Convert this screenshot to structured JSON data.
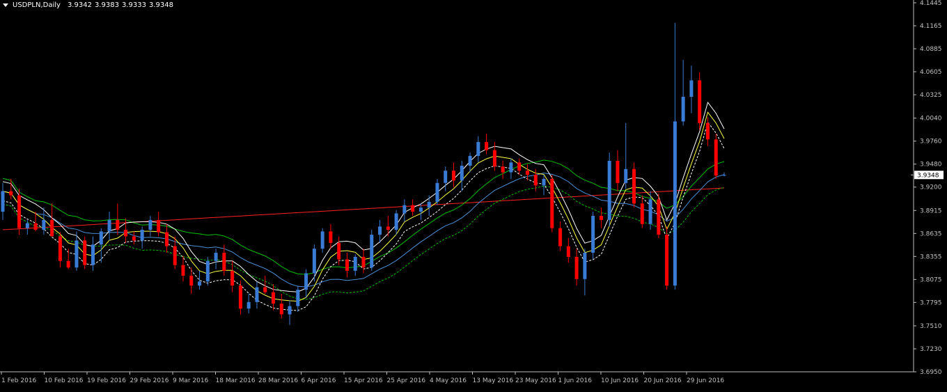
{
  "header": {
    "symbol": "USDPLN,Daily",
    "open": "3.9342",
    "high": "3.9383",
    "low": "3.9333",
    "close": "3.9348"
  },
  "colors": {
    "background": "#000000",
    "axis": "#c0c0c0",
    "bull_candle": "#3a7bd5",
    "bear_candle": "#ff0000",
    "price_tag_bg": "#ffffff",
    "ma_slow": "#ff2020",
    "env_green": "#00c000",
    "env_blue": "#4a90d9",
    "fast_white": "#ffffff",
    "fast_yellow": "#ffff40"
  },
  "chart_data": {
    "type": "candlestick",
    "symbol": "USDPLN",
    "timeframe": "Daily",
    "y_axis_side": "right",
    "ylim": [
      3.695,
      4.1445
    ],
    "y_ticks": [
      "4.1445",
      "4.1165",
      "4.0885",
      "4.0605",
      "4.0325",
      "4.0040",
      "3.9760",
      "3.9480",
      "3.9200",
      "3.8915",
      "3.8635",
      "3.8355",
      "3.8075",
      "3.7795",
      "3.7510",
      "3.7230",
      "3.6950"
    ],
    "current_price": "3.9348",
    "x_labels": [
      "1 Feb 2016",
      "10 Feb 2016",
      "19 Feb 2016",
      "29 Feb 2016",
      "9 Mar 2016",
      "18 Mar 2016",
      "28 Mar 2016",
      "6 Apr 2016",
      "15 Apr 2016",
      "25 Apr 2016",
      "4 May 2016",
      "13 May 2016",
      "23 May 2016",
      "1 Jun 2016",
      "10 Jun 2016",
      "20 Jun 2016",
      "29 Jun 2016"
    ],
    "candles": [
      {
        "o": 3.89,
        "h": 3.925,
        "l": 3.88,
        "c": 3.915
      },
      {
        "o": 3.915,
        "h": 3.93,
        "l": 3.905,
        "c": 3.91
      },
      {
        "o": 3.91,
        "h": 3.918,
        "l": 3.862,
        "c": 3.87
      },
      {
        "o": 3.87,
        "h": 3.88,
        "l": 3.862,
        "c": 3.876
      },
      {
        "o": 3.876,
        "h": 3.89,
        "l": 3.866,
        "c": 3.868
      },
      {
        "o": 3.868,
        "h": 3.895,
        "l": 3.862,
        "c": 3.88
      },
      {
        "o": 3.88,
        "h": 3.9,
        "l": 3.874,
        "c": 3.86
      },
      {
        "o": 3.86,
        "h": 3.865,
        "l": 3.822,
        "c": 3.83
      },
      {
        "o": 3.83,
        "h": 3.845,
        "l": 3.82,
        "c": 3.822
      },
      {
        "o": 3.822,
        "h": 3.866,
        "l": 3.818,
        "c": 3.855
      },
      {
        "o": 3.855,
        "h": 3.86,
        "l": 3.82,
        "c": 3.825
      },
      {
        "o": 3.825,
        "h": 3.86,
        "l": 3.818,
        "c": 3.85
      },
      {
        "o": 3.85,
        "h": 3.87,
        "l": 3.828,
        "c": 3.866
      },
      {
        "o": 3.866,
        "h": 3.89,
        "l": 3.855,
        "c": 3.88
      },
      {
        "o": 3.88,
        "h": 3.9,
        "l": 3.862,
        "c": 3.868
      },
      {
        "o": 3.868,
        "h": 3.882,
        "l": 3.852,
        "c": 3.86
      },
      {
        "o": 3.86,
        "h": 3.866,
        "l": 3.85,
        "c": 3.855
      },
      {
        "o": 3.855,
        "h": 3.872,
        "l": 3.845,
        "c": 3.868
      },
      {
        "o": 3.868,
        "h": 3.885,
        "l": 3.86,
        "c": 3.88
      },
      {
        "o": 3.88,
        "h": 3.89,
        "l": 3.86,
        "c": 3.865
      },
      {
        "o": 3.865,
        "h": 3.875,
        "l": 3.84,
        "c": 3.848
      },
      {
        "o": 3.848,
        "h": 3.86,
        "l": 3.82,
        "c": 3.825
      },
      {
        "o": 3.825,
        "h": 3.836,
        "l": 3.805,
        "c": 3.812
      },
      {
        "o": 3.812,
        "h": 3.822,
        "l": 3.79,
        "c": 3.8
      },
      {
        "o": 3.8,
        "h": 3.818,
        "l": 3.795,
        "c": 3.805
      },
      {
        "o": 3.805,
        "h": 3.835,
        "l": 3.8,
        "c": 3.83
      },
      {
        "o": 3.83,
        "h": 3.845,
        "l": 3.82,
        "c": 3.84
      },
      {
        "o": 3.84,
        "h": 3.85,
        "l": 3.812,
        "c": 3.818
      },
      {
        "o": 3.818,
        "h": 3.83,
        "l": 3.792,
        "c": 3.8
      },
      {
        "o": 3.8,
        "h": 3.806,
        "l": 3.765,
        "c": 3.772
      },
      {
        "o": 3.772,
        "h": 3.79,
        "l": 3.766,
        "c": 3.78
      },
      {
        "o": 3.78,
        "h": 3.805,
        "l": 3.772,
        "c": 3.798
      },
      {
        "o": 3.798,
        "h": 3.812,
        "l": 3.79,
        "c": 3.792
      },
      {
        "o": 3.792,
        "h": 3.802,
        "l": 3.77,
        "c": 3.778
      },
      {
        "o": 3.778,
        "h": 3.79,
        "l": 3.76,
        "c": 3.765
      },
      {
        "o": 3.765,
        "h": 3.782,
        "l": 3.752,
        "c": 3.775
      },
      {
        "o": 3.775,
        "h": 3.8,
        "l": 3.768,
        "c": 3.795
      },
      {
        "o": 3.795,
        "h": 3.82,
        "l": 3.785,
        "c": 3.815
      },
      {
        "o": 3.815,
        "h": 3.85,
        "l": 3.805,
        "c": 3.845
      },
      {
        "o": 3.845,
        "h": 3.87,
        "l": 3.84,
        "c": 3.866
      },
      {
        "o": 3.866,
        "h": 3.875,
        "l": 3.845,
        "c": 3.852
      },
      {
        "o": 3.852,
        "h": 3.86,
        "l": 3.825,
        "c": 3.832
      },
      {
        "o": 3.832,
        "h": 3.84,
        "l": 3.81,
        "c": 3.818
      },
      {
        "o": 3.818,
        "h": 3.838,
        "l": 3.812,
        "c": 3.835
      },
      {
        "o": 3.835,
        "h": 3.845,
        "l": 3.815,
        "c": 3.822
      },
      {
        "o": 3.822,
        "h": 3.868,
        "l": 3.818,
        "c": 3.862
      },
      {
        "o": 3.862,
        "h": 3.88,
        "l": 3.852,
        "c": 3.872
      },
      {
        "o": 3.872,
        "h": 3.885,
        "l": 3.86,
        "c": 3.868
      },
      {
        "o": 3.868,
        "h": 3.892,
        "l": 3.862,
        "c": 3.888
      },
      {
        "o": 3.888,
        "h": 3.905,
        "l": 3.878,
        "c": 3.898
      },
      {
        "o": 3.898,
        "h": 3.905,
        "l": 3.885,
        "c": 3.89
      },
      {
        "o": 3.89,
        "h": 3.9,
        "l": 3.88,
        "c": 3.895
      },
      {
        "o": 3.895,
        "h": 3.91,
        "l": 3.885,
        "c": 3.902
      },
      {
        "o": 3.902,
        "h": 3.93,
        "l": 3.898,
        "c": 3.925
      },
      {
        "o": 3.925,
        "h": 3.945,
        "l": 3.915,
        "c": 3.94
      },
      {
        "o": 3.94,
        "h": 3.95,
        "l": 3.92,
        "c": 3.928
      },
      {
        "o": 3.928,
        "h": 3.952,
        "l": 3.915,
        "c": 3.946
      },
      {
        "o": 3.946,
        "h": 3.962,
        "l": 3.938,
        "c": 3.958
      },
      {
        "o": 3.958,
        "h": 3.982,
        "l": 3.95,
        "c": 3.975
      },
      {
        "o": 3.975,
        "h": 3.985,
        "l": 3.96,
        "c": 3.965
      },
      {
        "o": 3.965,
        "h": 3.975,
        "l": 3.94,
        "c": 3.945
      },
      {
        "o": 3.945,
        "h": 3.952,
        "l": 3.93,
        "c": 3.938
      },
      {
        "o": 3.938,
        "h": 3.955,
        "l": 3.93,
        "c": 3.95
      },
      {
        "o": 3.95,
        "h": 3.955,
        "l": 3.935,
        "c": 3.94
      },
      {
        "o": 3.94,
        "h": 3.948,
        "l": 3.928,
        "c": 3.935
      },
      {
        "o": 3.935,
        "h": 3.942,
        "l": 3.915,
        "c": 3.922
      },
      {
        "o": 3.922,
        "h": 3.935,
        "l": 3.91,
        "c": 3.93
      },
      {
        "o": 3.93,
        "h": 3.935,
        "l": 3.865,
        "c": 3.87
      },
      {
        "o": 3.87,
        "h": 3.878,
        "l": 3.842,
        "c": 3.848
      },
      {
        "o": 3.848,
        "h": 3.858,
        "l": 3.828,
        "c": 3.835
      },
      {
        "o": 3.835,
        "h": 3.845,
        "l": 3.8,
        "c": 3.808
      },
      {
        "o": 3.808,
        "h": 3.845,
        "l": 3.788,
        "c": 3.84
      },
      {
        "o": 3.84,
        "h": 3.89,
        "l": 3.832,
        "c": 3.885
      },
      {
        "o": 3.885,
        "h": 3.895,
        "l": 3.87,
        "c": 3.88
      },
      {
        "o": 3.88,
        "h": 3.962,
        "l": 3.872,
        "c": 3.952
      },
      {
        "o": 3.952,
        "h": 3.965,
        "l": 3.915,
        "c": 3.925
      },
      {
        "o": 3.925,
        "h": 3.998,
        "l": 3.918,
        "c": 3.942
      },
      {
        "o": 3.942,
        "h": 3.95,
        "l": 3.895,
        "c": 3.9
      },
      {
        "o": 3.9,
        "h": 3.91,
        "l": 3.87,
        "c": 3.875
      },
      {
        "o": 3.875,
        "h": 3.915,
        "l": 3.868,
        "c": 3.905
      },
      {
        "o": 3.905,
        "h": 3.912,
        "l": 3.858,
        "c": 3.862
      },
      {
        "o": 3.862,
        "h": 3.872,
        "l": 3.795,
        "c": 3.8
      },
      {
        "o": 3.8,
        "h": 4.12,
        "l": 3.795,
        "c": 4.0
      },
      {
        "o": 4.0,
        "h": 4.075,
        "l": 3.995,
        "c": 4.03
      },
      {
        "o": 4.03,
        "h": 4.068,
        "l": 4.01,
        "c": 4.05
      },
      {
        "o": 4.05,
        "h": 4.06,
        "l": 3.99,
        "c": 3.998
      },
      {
        "o": 3.998,
        "h": 4.005,
        "l": 3.97,
        "c": 3.978
      },
      {
        "o": 3.978,
        "h": 3.985,
        "l": 3.93,
        "c": 3.934
      },
      {
        "o": 3.934,
        "h": 3.938,
        "l": 3.933,
        "c": 3.935
      }
    ]
  }
}
